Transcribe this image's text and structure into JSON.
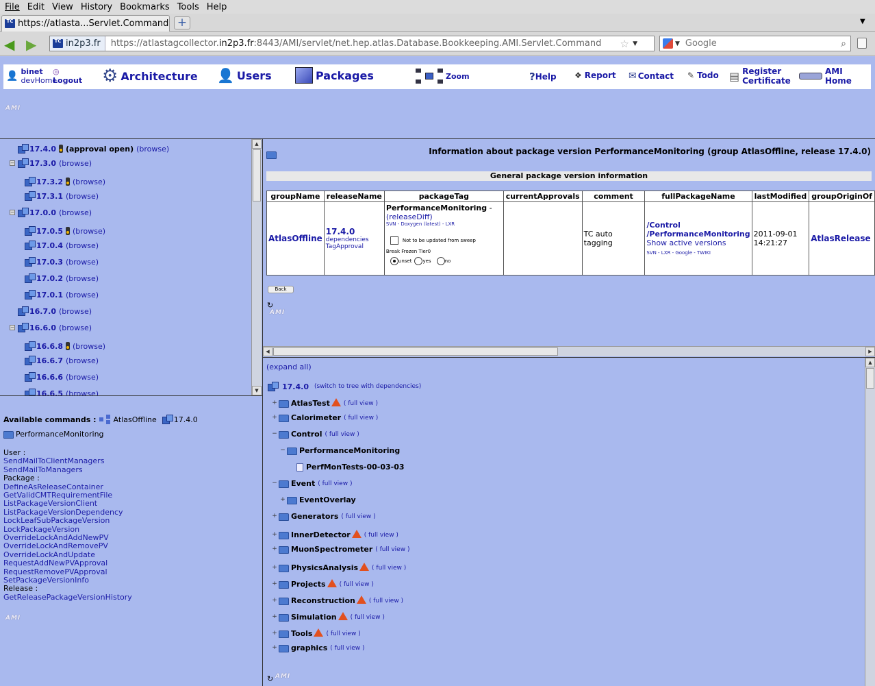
{
  "menu": [
    "File",
    "Edit",
    "View",
    "History",
    "Bookmarks",
    "Tools",
    "Help"
  ],
  "tab": {
    "title": "https://atlasta...Servlet.Command",
    "favicon": "TC"
  },
  "nav": {
    "identity": "in2p3.fr",
    "url_prefix": "https://atlastagcollector.",
    "url_domain": "in2p3.fr",
    "url_rest": ":8443/AMI/servlet/net.hep.atlas.Database.Bookkeeping.AMI.Servlet.Command",
    "search_placeholder": "Google"
  },
  "amibar": {
    "user": "binet",
    "user_sub": "devHome",
    "logout": "Logout",
    "architecture": "Architecture",
    "users": "Users",
    "packages": "Packages",
    "zoom": "Zoom",
    "help": "Help",
    "report": "Report",
    "contact": "Contact",
    "todo": "Todo",
    "register1": "Register",
    "register2": "Certificate",
    "ami1": "AMI",
    "ami2": "Home"
  },
  "logo": "AMI",
  "tree": [
    {
      "label": "17.4.0",
      "extra": "(approval open)",
      "browse": "(browse)"
    },
    {
      "label": "17.3.0",
      "browse": "(browse)"
    },
    {
      "label": "17.3.2",
      "browse": "(browse)"
    },
    {
      "label": "17.3.1",
      "browse": "(browse)"
    },
    {
      "label": "17.0.0",
      "browse": "(browse)"
    },
    {
      "label": "17.0.5",
      "browse": "(browse)"
    },
    {
      "label": "17.0.4",
      "browse": "(browse)"
    },
    {
      "label": "17.0.3",
      "browse": "(browse)"
    },
    {
      "label": "17.0.2",
      "browse": "(browse)"
    },
    {
      "label": "17.0.1",
      "browse": "(browse)"
    },
    {
      "label": "16.7.0",
      "browse": "(browse)"
    },
    {
      "label": "16.6.0",
      "browse": "(browse)"
    },
    {
      "label": "16.6.8",
      "browse": "(browse)"
    },
    {
      "label": "16.6.7",
      "browse": "(browse)"
    },
    {
      "label": "16.6.6",
      "browse": "(browse)"
    },
    {
      "label": "16.6.5",
      "browse": "(browse)"
    }
  ],
  "commands": {
    "title": "Available commands :",
    "group": "AtlasOffline",
    "release": "17.4.0",
    "package": "PerformanceMonitoring",
    "user_label": "User :",
    "user_cmds": [
      "SendMailToClientManagers",
      "SendMailToManagers"
    ],
    "package_label": "Package :",
    "package_cmds": [
      "DefineAsReleaseContainer",
      "GetValidCMTRequirementFile",
      "ListPackageVersionClient",
      "ListPackageVersionDependency",
      "LockLeafSubPackageVersion",
      "LockPackageVersion",
      "OverrideLockAndAddNewPV",
      "OverrideLockAndRemovePV",
      "OverrideLockAndUpdate",
      "RequestAddNewPVApproval",
      "RequestRemovePVApproval",
      "SetPackageVersionInfo"
    ],
    "release_label": "Release :",
    "release_cmds": [
      "GetReleasePackageVersionHistory"
    ]
  },
  "info": {
    "title": "Information about package version PerformanceMonitoring (group AtlasOffline, release 17.4.0)",
    "section": "General package version information",
    "headers": [
      "groupName",
      "releaseName",
      "packageTag",
      "currentApprovals",
      "comment",
      "fullPackageName",
      "lastModified",
      "groupOriginOf"
    ],
    "groupName": "AtlasOffline",
    "releaseName": "17.4.0",
    "dependencies": "dependencies",
    "tagApproval": "TagApproval",
    "packageTag": "PerformanceMonitoring",
    "releaseDiff": "(releaseDiff)",
    "tagLinks": "SVN - Doxygen (latest) - LXR",
    "sweepLabel": "Not to be updated from sweep",
    "breakLabel": "Break Frozen Tier0",
    "radio_unset": "unset",
    "radio_yes": "yes",
    "radio_no": "no",
    "comment": "TC auto tagging",
    "fullPackageName1": "/Control",
    "fullPackageName2": "/PerformanceMonitoring",
    "showActive": "Show active versions",
    "fullLinks": "SVN - LXR - Google - TWIKI",
    "lastModified1": "2011-09-01",
    "lastModified2": "14:21:27",
    "groupOrigin": "AtlasRelease",
    "back": "Back"
  },
  "rtree": {
    "expand_all": "(expand all)",
    "root": "17.4.0",
    "root_link": "(switch to tree with dependencies)",
    "full_view": "full view",
    "items": [
      {
        "label": "AtlasTest",
        "warn": true
      },
      {
        "label": "Calorimeter",
        "warn": false
      },
      {
        "label": "Control",
        "warn": false
      },
      {
        "label": "PerformanceMonitoring",
        "warn": false
      },
      {
        "label": "PerfMonTests-00-03-03",
        "warn": false
      },
      {
        "label": "Event",
        "warn": false
      },
      {
        "label": "EventOverlay",
        "warn": false
      },
      {
        "label": "Generators",
        "warn": false
      },
      {
        "label": "InnerDetector",
        "warn": true
      },
      {
        "label": "MuonSpectrometer",
        "warn": false
      },
      {
        "label": "PhysicsAnalysis",
        "warn": true
      },
      {
        "label": "Projects",
        "warn": true
      },
      {
        "label": "Reconstruction",
        "warn": true
      },
      {
        "label": "Simulation",
        "warn": true
      },
      {
        "label": "Tools",
        "warn": true
      },
      {
        "label": "graphics",
        "warn": false
      }
    ]
  }
}
